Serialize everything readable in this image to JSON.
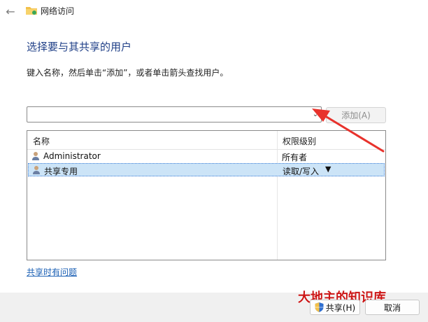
{
  "window": {
    "title": "网络访问"
  },
  "header": {
    "heading": "选择要与其共享的用户",
    "description": "键入名称，然后单击“添加”，或者单击箭头查找用户。"
  },
  "input": {
    "value": "",
    "add_label": "添加(A)"
  },
  "table": {
    "columns": [
      "名称",
      "权限级别"
    ],
    "rows": [
      {
        "name": "Administrator",
        "permission": "所有者",
        "selected": false
      },
      {
        "name": "共享专用",
        "permission": "读取/写入",
        "selected": true
      }
    ]
  },
  "help_link": "共享时有问题",
  "footer": {
    "share_label": "共享(H)",
    "cancel_label": "取消"
  },
  "watermark": "大地主的知识库",
  "icons": [
    "back-arrow-icon",
    "network-folder-icon",
    "dropdown-arrow-icon",
    "user-icon",
    "shield-icon"
  ],
  "colors": {
    "heading": "#1f3f87",
    "link": "#1a5fb4",
    "selection": "#cce4f7",
    "annotation_arrow": "#e8322c",
    "watermark": "#cc1616"
  }
}
